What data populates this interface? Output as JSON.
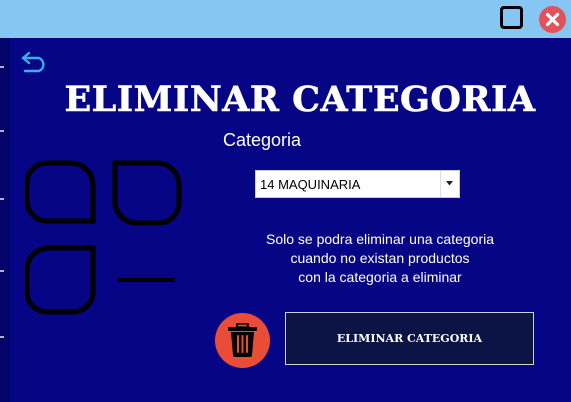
{
  "window": {
    "title": "",
    "controls": {
      "maximize_icon": "square-icon",
      "close_icon": "close-x-icon"
    }
  },
  "nav": {
    "back_icon": "undo-arrow-icon"
  },
  "page": {
    "title": "ELIMINAR CATEGORIA",
    "category_label": "Categoria",
    "category_select": {
      "value": "14 MAQUINARIA"
    },
    "note_lines": [
      "Solo se podra eliminar una categoria",
      "cuando no existan productos",
      "con la categoria a eliminar"
    ],
    "trash_icon": "trash-icon",
    "delete_button_label": "ELIMINAR CATEGORIA",
    "illustration_icon": "category-shapes-icon"
  },
  "colors": {
    "titlebar": "#87c6f3",
    "background": "#050585",
    "close": "#e4515b",
    "trash": "#ea4d37",
    "button": "#0c1445",
    "back_icon": "#3ab0e8"
  }
}
